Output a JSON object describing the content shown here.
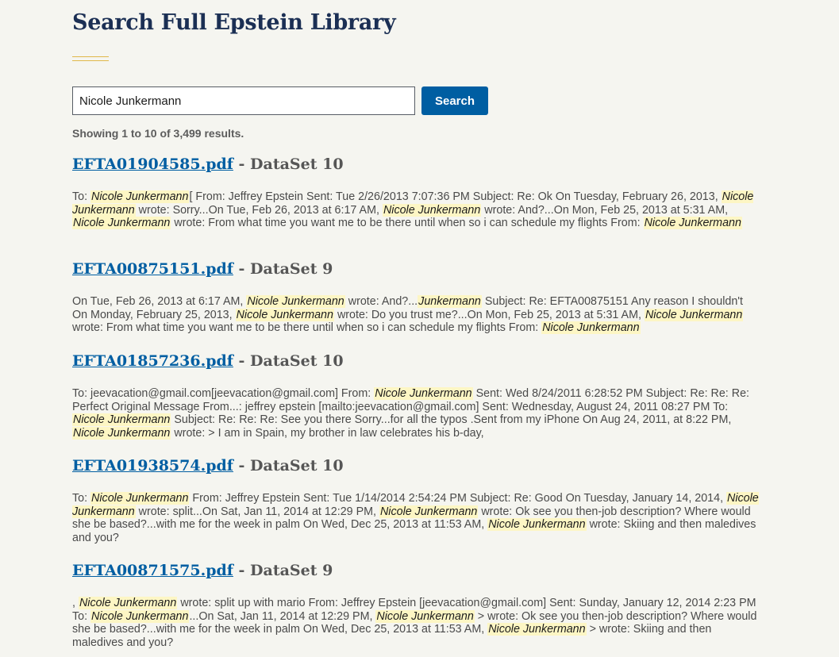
{
  "page": {
    "title": "Search Full Epstein Library",
    "search": {
      "value": "Nicole Junkermann",
      "button_label": "Search"
    },
    "results_count": "Showing 1 to 10 of 3,499 results."
  },
  "results": [
    {
      "file": "EFTA01904585.pdf",
      "dataset": " - DataSet 10",
      "snippet": [
        {
          "t": "To: "
        },
        {
          "h": "Nicole Junkermann"
        },
        {
          "t": "[ From: Jeffrey Epstein Sent: Tue 2/26/2013 7:07:36 PM Subject: Re: Ok On Tuesday, February 26, 2013, "
        },
        {
          "h": "Nicole Junkermann"
        },
        {
          "t": " wrote: Sorry...On Tue, Feb 26, 2013 at 6:17 AM, "
        },
        {
          "h": "Nicole Junkermann"
        },
        {
          "t": " wrote: And?...On Mon, Feb 25, 2013 at 5:31 AM, "
        },
        {
          "h": "Nicole Junkermann"
        },
        {
          "t": " wrote: From what time you want me to be there until when so i can schedule my flights From: "
        },
        {
          "h": "Nicole Junkermann"
        }
      ]
    },
    {
      "file": "EFTA00875151.pdf",
      "dataset": " - DataSet 9",
      "snippet": [
        {
          "t": "On Tue, Feb 26, 2013 at 6:17 AM, "
        },
        {
          "h": "Nicole Junkermann"
        },
        {
          "t": " wrote: And?..."
        },
        {
          "h": "Junkermann"
        },
        {
          "t": " Subject: Re: EFTA00875151 Any reason I shouldn't On Monday, February 25, 2013, "
        },
        {
          "h": "Nicole Junkermann"
        },
        {
          "t": " wrote: Do you trust me?...On Mon, Feb 25, 2013 at 5:31 AM, "
        },
        {
          "h": "Nicole Junkermann"
        },
        {
          "t": " wrote: From what time you want me to be there until when so i can schedule my flights From: "
        },
        {
          "h": "Nicole Junkermann"
        }
      ]
    },
    {
      "file": "EFTA01857236.pdf",
      "dataset": " - DataSet 10",
      "snippet": [
        {
          "t": "To: jeevacation@gmail.com[jeevacation@gmail.com] From: "
        },
        {
          "h": "Nicole Junkermann"
        },
        {
          "t": " Sent: Wed 8/24/2011 6:28:52 PM Subject: Re: Re: Re: Perfect Original Message From...: jeffrey epstein [mailto:jeevacation@gmail.com] Sent: Wednesday, August 24, 2011 08:27 PM To: "
        },
        {
          "h": "Nicole Junkermann"
        },
        {
          "t": " Subject: Re: Re: Re: See you there Sorry...for all the typos .Sent from my iPhone On Aug 24, 2011, at 8:22 PM, "
        },
        {
          "h": "Nicole Junkermann"
        },
        {
          "t": " wrote: > I am in Spain, my brother in law celebrates his b-day,"
        }
      ]
    },
    {
      "file": "EFTA01938574.pdf",
      "dataset": " - DataSet 10",
      "snippet": [
        {
          "t": "To: "
        },
        {
          "h": "Nicole Junkermann"
        },
        {
          "t": " From: Jeffrey Epstein Sent: Tue 1/14/2014 2:54:24 PM Subject: Re: Good On Tuesday, January 14, 2014, "
        },
        {
          "h": "Nicole Junkermann"
        },
        {
          "t": " wrote: split...On Sat, Jan 11, 2014 at 12:29 PM, "
        },
        {
          "h": "Nicole Junkermann"
        },
        {
          "t": " wrote: Ok see you then-job description? Where would she be based?...with me for the week in palm On Wed, Dec 25, 2013 at 11:53 AM, "
        },
        {
          "h": "Nicole Junkermann"
        },
        {
          "t": " wrote: Skiing and then maledives and you?"
        }
      ]
    },
    {
      "file": "EFTA00871575.pdf",
      "dataset": " - DataSet 9",
      "snippet": [
        {
          "t": ", "
        },
        {
          "h": "Nicole Junkermann"
        },
        {
          "t": " wrote: split up with mario From: Jeffrey Epstein [jeevacation@gmail.com] Sent: Sunday, January 12, 2014 2:23 PM To: "
        },
        {
          "h": "Nicole Junkermann"
        },
        {
          "t": "...On Sat, Jan 11, 2014 at 12:29 PM, "
        },
        {
          "h": "Nicole Junkermann"
        },
        {
          "t": " > wrote: Ok see you then-job description? Where would she be based?...with me for the week in palm On Wed, Dec 25, 2013 at 11:53 AM, "
        },
        {
          "h": "Nicole Junkermann"
        },
        {
          "t": " > wrote: Skiing and then maledives and you?"
        }
      ]
    }
  ]
}
